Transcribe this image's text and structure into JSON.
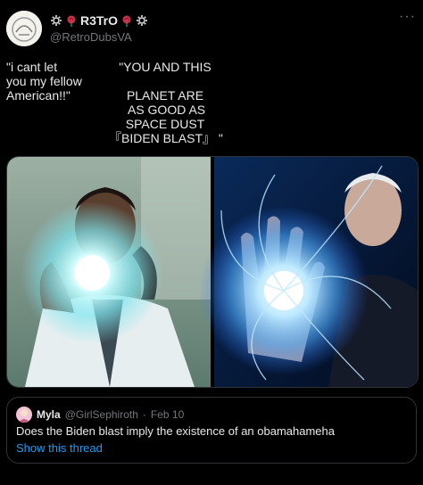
{
  "author": {
    "display_name": "R3TrO",
    "handle": "@RetroDubsVA",
    "name_icons": [
      "gear-icon",
      "rose-icon",
      "rose-icon",
      "gear-icon"
    ],
    "more_label": "···"
  },
  "tweet": {
    "left_caption": "\"i cant let\nyou my fellow\nAmerican!!\"",
    "right_caption": "\"YOU AND THIS\n\nPLANET ARE\n AS GOOD AS\nSPACE DUST\n『BIDEN BLAST』 \""
  },
  "media": {
    "panels": [
      "left-energy-blast-photo",
      "right-energy-blast-photo"
    ]
  },
  "quote": {
    "name": "Myla",
    "handle": "@GirlSephiroth",
    "separator": "·",
    "date": "Feb 10",
    "text": "Does the Biden blast imply the existence of an obamahameha",
    "thread_link": "Show this thread"
  },
  "colors": {
    "background": "#000000",
    "text": "#e7e9ea",
    "muted": "#71767b",
    "link": "#1d9bf0",
    "border": "#2f3336",
    "glow": "#9ff4ff"
  }
}
